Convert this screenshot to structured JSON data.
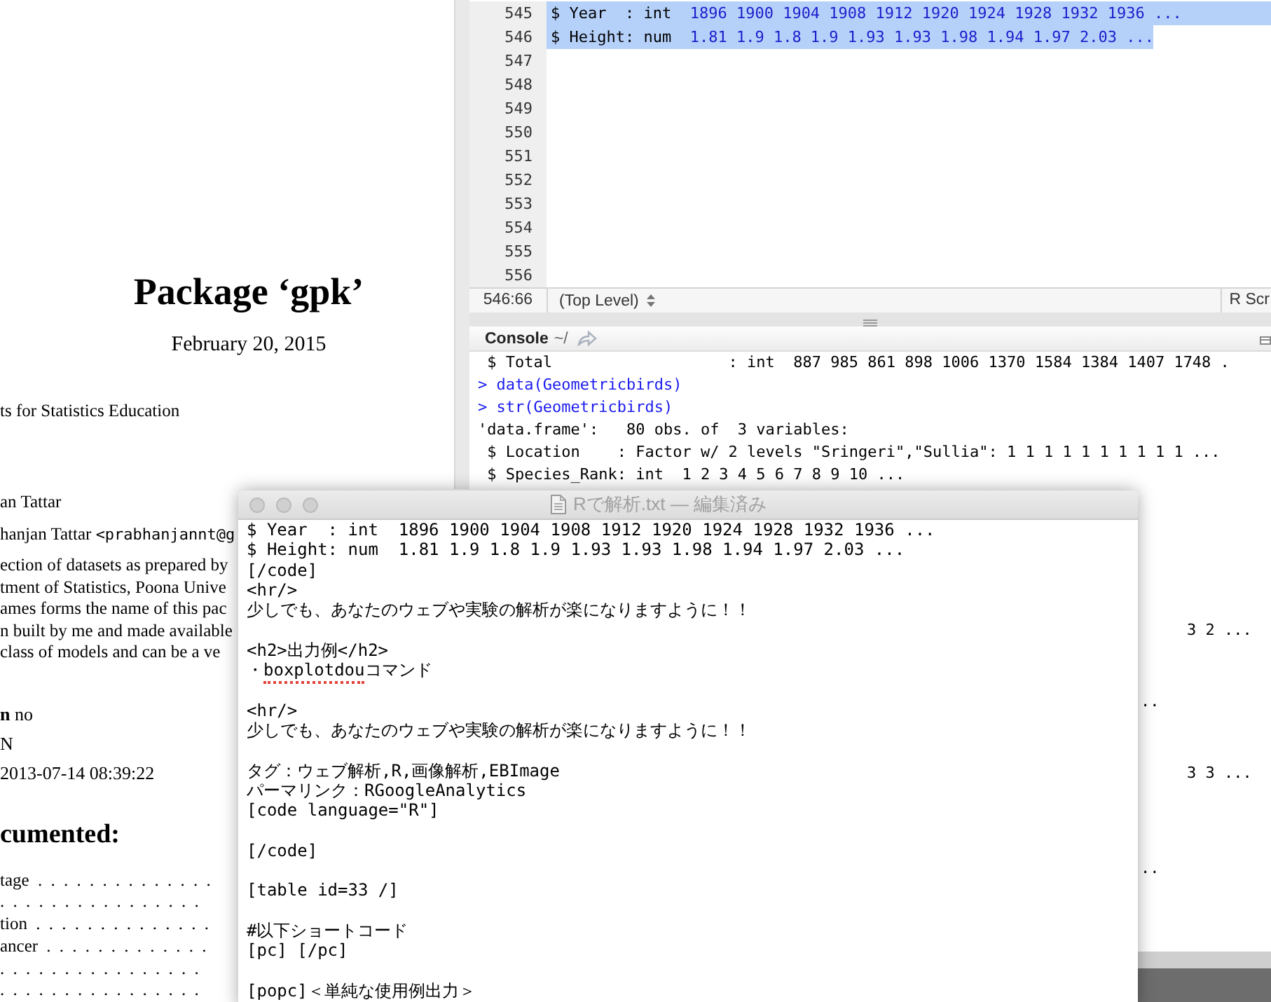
{
  "pdf_viewer": {
    "title": "Package ‘gpk’",
    "date": "February 20, 2015",
    "title_line": "ts for Statistics Education",
    "author": "an Tattar",
    "maintainer": {
      "name": "hanjan Tattar ",
      "email": "<prabhanjannt@g"
    },
    "description": [
      "ection of datasets as prepared by",
      "tment of Statistics, Poona Unive",
      "ames forms the name of this pac",
      "n built by me and made available",
      "class of models and can be a ve"
    ],
    "fields": [
      "**n**  no",
      "N",
      "2013-07-14 08:39:22"
    ],
    "section_heading": "cumented:",
    "toc": [
      "tage . . . . . . . . . . . . . .",
      ". . . . . . . . . . . . . . . .",
      "tion . . . . . . . . . . . . . .",
      "ancer . . . . . . . . . . . . .",
      ". . . . . . . . . . . . . . . .",
      ". . . . . . . . . . . . . . . ."
    ]
  },
  "rstudio": {
    "editor": {
      "lines": [
        {
          "number": "545",
          "code": "$ Year  : int  ",
          "values": "1896 1900 1904 1908 1912 1920 1924 1928 1932 1936 ...",
          "selected": true
        },
        {
          "number": "546",
          "code": "$ Height: num  ",
          "values": "1.81 1.9 1.8 1.9 1.93 1.93 1.98 1.94 1.97 2.03 ...",
          "selected": true
        },
        {
          "number": "547",
          "selected": false
        },
        {
          "number": "548",
          "selected": false
        },
        {
          "number": "549",
          "selected": false
        },
        {
          "number": "550",
          "selected": false
        },
        {
          "number": "551",
          "selected": false
        },
        {
          "number": "552",
          "selected": false
        },
        {
          "number": "553",
          "selected": false
        },
        {
          "number": "554",
          "selected": false
        },
        {
          "number": "555",
          "selected": false
        },
        {
          "number": "556",
          "selected": false
        }
      ]
    },
    "status_bar": {
      "position": "546:66",
      "scope": "(Top Level)",
      "file_type": "R Scr"
    },
    "console": {
      "title": "Console",
      "path": "~/",
      "lines": [
        {
          "kind": "output",
          "text": " $ Total                   : int  887 985 861 898 1006 1370 1584 1384 1407 1748 ."
        },
        {
          "kind": "input",
          "text": "> data(Geometricbirds)"
        },
        {
          "kind": "input",
          "text": "> str(Geometricbirds)"
        },
        {
          "kind": "output",
          "text": "'data.frame':   80 obs. of  3 variables:"
        },
        {
          "kind": "output",
          "text": " $ Location    : Factor w/ 2 levels \"Sringeri\",\"Sullia\": 1 1 1 1 1 1 1 1 1 1 ..."
        },
        {
          "kind": "output",
          "text": " $ Species_Rank: int  1 2 3 4 5 6 7 8 9 10 ..."
        }
      ],
      "fragments": [
        "3 2 ...",
        "..",
        "3 3 ...",
        ".."
      ]
    }
  },
  "text_editor": {
    "title": "Rで解析.txt — 編集済み",
    "lines": [
      {
        "kind": "text",
        "segments": [
          {
            "text": "$ Year  : int  1896 1900 1904 1908 1912 1920 1924 1928 1932 1936 ..."
          }
        ]
      },
      {
        "kind": "text",
        "segments": [
          {
            "text": "$ Height: num  1.81 1.9 1.8 1.9 1.93 1.93 1.98 1.94 1.97 2.03 ..."
          }
        ]
      },
      {
        "kind": "text",
        "segments": [
          {
            "text": "[/code]"
          }
        ]
      },
      {
        "kind": "text",
        "segments": [
          {
            "text": "<hr/>"
          }
        ]
      },
      {
        "kind": "text",
        "segments": [
          {
            "text": "少しでも、あなたのウェブや実験の解析が楽になりますように！！"
          }
        ]
      },
      {
        "kind": "blank"
      },
      {
        "kind": "text",
        "segments": [
          {
            "text": "<h2>出力例</h2>"
          }
        ]
      },
      {
        "kind": "text",
        "segments": [
          {
            "text": "・"
          },
          {
            "text": "boxplotdou",
            "misspelled": true
          },
          {
            "text": "コマンド"
          }
        ]
      },
      {
        "kind": "blank"
      },
      {
        "kind": "text",
        "segments": [
          {
            "text": "<hr/>"
          }
        ]
      },
      {
        "kind": "text",
        "segments": [
          {
            "text": "少しでも、あなたのウェブや実験の解析が楽になりますように！！"
          }
        ]
      },
      {
        "kind": "blank"
      },
      {
        "kind": "text",
        "segments": [
          {
            "text": "タグ：ウェブ解析,R,画像解析,EBImage"
          }
        ]
      },
      {
        "kind": "text",
        "segments": [
          {
            "text": "パーマリンク：RGoogleAnalytics"
          }
        ]
      },
      {
        "kind": "text",
        "segments": [
          {
            "text": "[code language=\"R\"]"
          }
        ]
      },
      {
        "kind": "blank"
      },
      {
        "kind": "text",
        "segments": [
          {
            "text": "[/code]"
          }
        ]
      },
      {
        "kind": "blank"
      },
      {
        "kind": "text",
        "segments": [
          {
            "text": "[table id=33 /]"
          }
        ]
      },
      {
        "kind": "blank"
      },
      {
        "kind": "text",
        "segments": [
          {
            "text": "#以下ショートコード"
          }
        ]
      },
      {
        "kind": "text",
        "segments": [
          {
            "text": "[pc] [/pc]"
          }
        ]
      },
      {
        "kind": "blank"
      },
      {
        "kind": "text",
        "segments": [
          {
            "text": "[popc]＜単純な使用例出力＞"
          }
        ]
      }
    ]
  }
}
